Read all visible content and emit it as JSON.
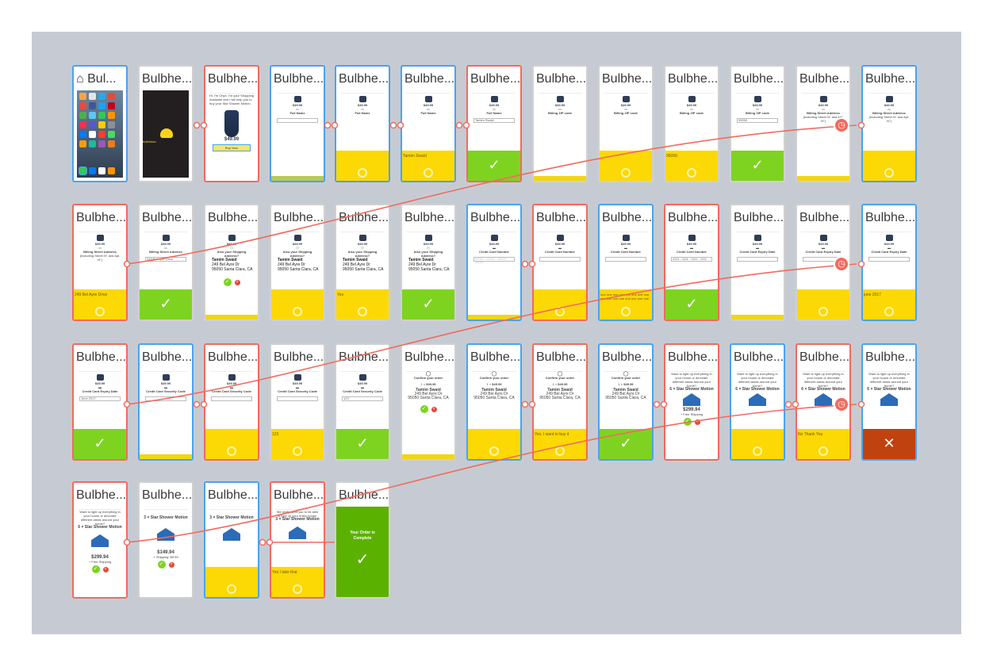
{
  "card_title": "Bulbhe...",
  "first_card_title": "Bul...",
  "home_label": "Home",
  "splash_label": "bulbhead",
  "row1": {
    "intro_text": "Hi, I'm Onyx, I'm your Shopping Assistant and I will help you to buy your Star Shower Motion.",
    "price": "$49.99",
    "buy_button": "Buy Now",
    "full_name": "Full Name",
    "spoken_name": "Tamim Swaid",
    "typed_name": "Tamim Swaid",
    "billing_zip": "Billing ZIP code",
    "zip_value": "95050",
    "billing_street": "Billing Street Address",
    "billing_street_hint": "(Including Street N° and Apt. N°)"
  },
  "row2": {
    "street_spoken": "249 Bel Ayre Drive",
    "street_typed": "249 Bel Ayre Drive",
    "shipping_question": "Also your Shipping Address?",
    "addr_name": "Tamim Swaid",
    "addr_line1": "249 Bel Ayre Dr",
    "addr_line2": "95050 Santa Clara, CA",
    "yes": "Yes",
    "cc_number": "Credit Card Number",
    "cc_placeholder": "XXXX - XXXX - XXXX - XXXX",
    "cc_spoken": "four one one one one one one one one one one one one one one one",
    "cc_typed": "4111 - 1111 - 1111 - 1111",
    "cc_expiry": "Credit Card Expiry Date",
    "expiry_spoken": "june 2017"
  },
  "row3": {
    "expiry_typed": "June 2017",
    "cc_security": "Credit Card Security Code",
    "security_spoken": "123",
    "security_typed": "123",
    "confirm": "Confirm your order",
    "qty": "1 ×",
    "confirm_spoken": "Yes, I want to buy it",
    "upsell_question": "Want to light up everything in your house or decorate different areas around your home?",
    "upsell_product": "6 × Star Shower Motion",
    "upsell_price": "$299.94",
    "upsell_shipping": "+ Free Shipping",
    "decline_spoken": "No Thank You"
  },
  "row4": {
    "upsell_product_3": "3 × Star Shower Motion",
    "price_3": "$149.94",
    "shipping_3": "+ Shipping: $9.99",
    "entire_house": "We really want you to be able to light up your entire house.",
    "like_spoken": "Yes I take that",
    "order_complete": "Your Order is Complete"
  },
  "colors": {
    "blue_border": "#4aa3ee",
    "red_border": "#f26a5d",
    "yellow": "#fcd804",
    "green": "#7ed321",
    "cancel": "#c0420e",
    "connector": "#f26a5d",
    "canvas": "#c6cbd3"
  }
}
